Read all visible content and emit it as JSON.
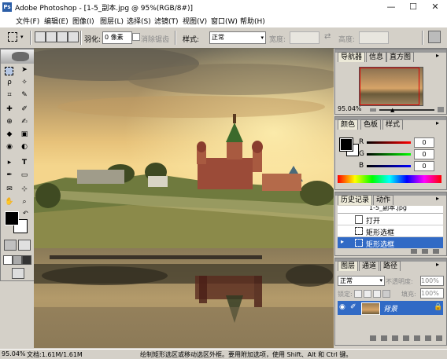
{
  "window": {
    "app_title": "Adobe Photoshop - [1-5_副本.jpg @ 95%(RGB/8#)]",
    "logo_text": "Ps",
    "min_glyph": "—",
    "max_glyph": "☐",
    "close_glyph": "✕"
  },
  "menus": [
    {
      "label": "文件(F)"
    },
    {
      "label": "编辑(E)"
    },
    {
      "label": "图像(I)"
    },
    {
      "label": "图层(L)"
    },
    {
      "label": "选择(S)"
    },
    {
      "label": "滤镜(T)"
    },
    {
      "label": "视图(V)"
    },
    {
      "label": "窗口(W)"
    },
    {
      "label": "帮助(H)"
    }
  ],
  "options": {
    "feather_label": "羽化:",
    "feather_value": "0 像素",
    "antialias_label": "消除锯齿",
    "style_label": "样式:",
    "style_value": "正常",
    "width_label": "宽度:",
    "height_label": "高度:"
  },
  "toolbox": {
    "tools": [
      "[ ]",
      "▸",
      "ρ",
      "✧",
      "⊥",
      "✎",
      "✚",
      "⊕",
      "✐",
      "☗",
      "◆",
      "▣",
      "◢",
      "✋",
      "T",
      "⊹",
      "✍",
      "◉",
      "✚",
      "⌕"
    ]
  },
  "canvas": {
    "description_free": true
  },
  "navigator": {
    "tabs": [
      "导航器",
      "信息",
      "直方图"
    ],
    "zoom": "95.04%"
  },
  "color": {
    "tabs": [
      "颜色",
      "色板",
      "样式"
    ],
    "r_label": "R",
    "g_label": "G",
    "b_label": "B",
    "r_value": "0",
    "g_value": "0",
    "b_value": "0",
    "fg": "#000000",
    "bg": "#ffffff"
  },
  "history": {
    "tabs": [
      "历史记录",
      "动作"
    ],
    "snapshot": "1-5_副本.jpg",
    "items": [
      {
        "label": "打开"
      },
      {
        "label": "矩形选框"
      },
      {
        "label": "矩形选框"
      }
    ]
  },
  "layers": {
    "tabs": [
      "图层",
      "通道",
      "路径"
    ],
    "blend_mode": "正常",
    "opacity_label": "不透明度:",
    "opacity_value": "100%",
    "lock_label": "锁定:",
    "fill_label": "填充:",
    "fill_value": "100%",
    "layer_name": "背景"
  },
  "status": {
    "zoom": "95.04%",
    "doc": "文档:1.61M/1.61M",
    "hint": "绘制矩形选区或移动选区外框。要用附加选项，使用 Shift、Alt 和 Ctrl 键。"
  },
  "colors": {
    "accent": "#316ac5",
    "panel_bg": "#d4d0c8"
  }
}
